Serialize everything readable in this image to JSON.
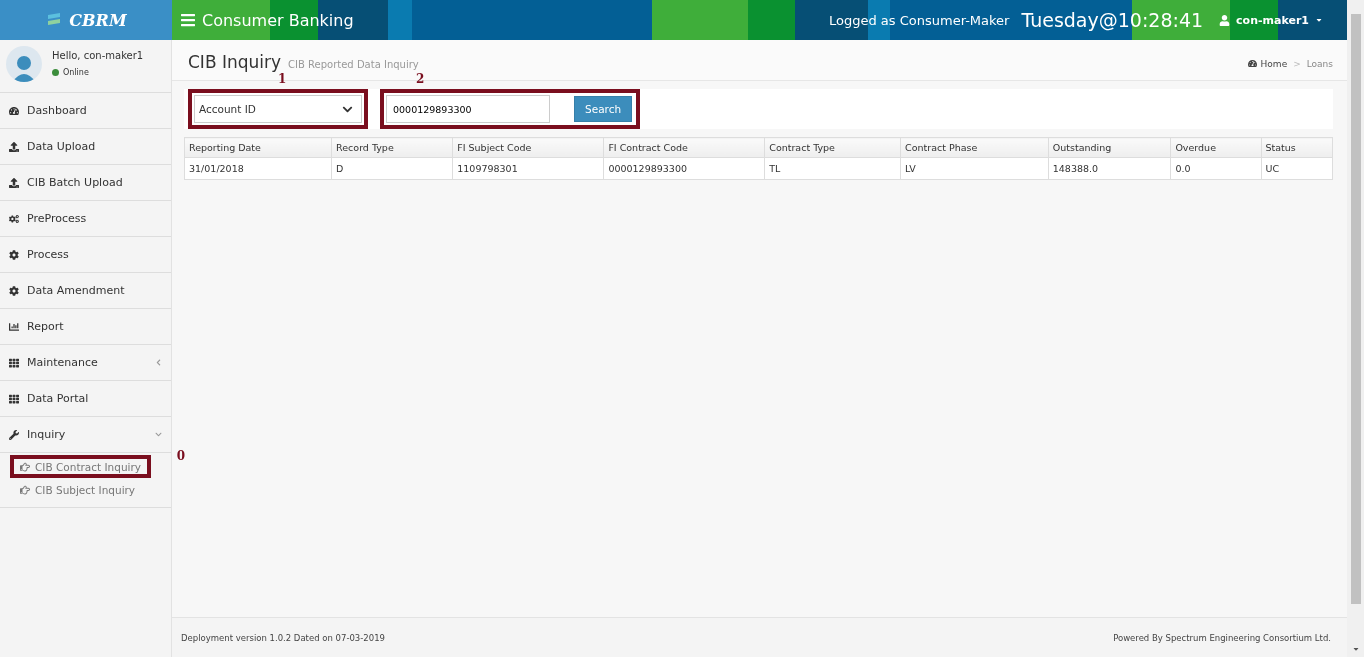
{
  "header": {
    "logo": "CBRM",
    "title": "Consumer Banking",
    "logged_as": "Logged as Consumer-Maker",
    "clock": "Tuesday@10:28:41",
    "user": "con-maker1"
  },
  "user_panel": {
    "greeting": "Hello, con-maker1",
    "status": "Online"
  },
  "sidebar": {
    "items": [
      {
        "label": "Dashboard"
      },
      {
        "label": "Data Upload"
      },
      {
        "label": "CIB Batch Upload"
      },
      {
        "label": "PreProcess"
      },
      {
        "label": "Process"
      },
      {
        "label": "Data Amendment"
      },
      {
        "label": "Report"
      },
      {
        "label": "Maintenance",
        "expanded": false
      },
      {
        "label": "Data Portal"
      },
      {
        "label": "Inquiry",
        "expanded": true,
        "children": [
          {
            "label": "CIB Contract Inquiry",
            "annotation": "0"
          },
          {
            "label": "CIB Subject Inquiry"
          }
        ]
      }
    ]
  },
  "page": {
    "title": "CIB Inquiry",
    "subtitle": "CIB Reported Data Inquiry",
    "breadcrumb": [
      "Home",
      "Loans"
    ],
    "breadcrumb_separator": ">"
  },
  "filter": {
    "select": {
      "value": "Account ID",
      "annotation": "1"
    },
    "search": {
      "value": "0000129893300",
      "button": "Search",
      "annotation": "2"
    }
  },
  "table": {
    "columns": [
      "Reporting Date",
      "Record Type",
      "FI Subject Code",
      "FI Contract Code",
      "Contract Type",
      "Contract Phase",
      "Outstanding",
      "Overdue",
      "Status"
    ],
    "rows": [
      [
        "31/01/2018",
        "D",
        "1109798301",
        "0000129893300",
        "TL",
        "LV",
        "148388.0",
        "0.0",
        "UC"
      ]
    ]
  },
  "footer": {
    "left": "Deployment version 1.0.2 Dated on 07-03-2019",
    "right": "Powered By Spectrum Engineering Consortium Ltd."
  }
}
